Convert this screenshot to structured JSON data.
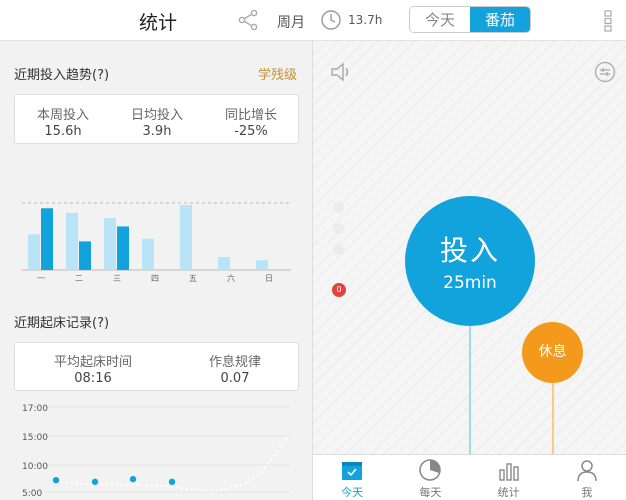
{
  "header": {
    "title": "统计",
    "period": "周月",
    "hours": "13.7h",
    "tab_today": "今天",
    "tab_tomato": "番茄",
    "icons": {
      "share": "share-icon",
      "clock": "clock-icon",
      "more": "more-vertical-icon"
    }
  },
  "trend": {
    "title": "近期投入趋势(?)",
    "level": "学残级",
    "stats": [
      {
        "label": "本周投入",
        "value": "15.6h"
      },
      {
        "label": "日均投入",
        "value": "3.9h"
      },
      {
        "label": "同比增长",
        "value": "-25%"
      }
    ]
  },
  "chart_data": [
    {
      "type": "bar",
      "categories": [
        "一",
        "二",
        "三",
        "四",
        "五",
        "六",
        "日"
      ],
      "series": [
        {
          "values": [
            0.55,
            0.88,
            0.8,
            0.48,
            1.0,
            0.2,
            0.15
          ],
          "color": "#b9e3f6"
        },
        {
          "values": [
            0.95,
            0.44,
            0.67,
            null,
            null,
            null,
            null
          ],
          "color": "#13a3dc"
        }
      ],
      "baseline_dashed": true,
      "grid": false
    },
    {
      "type": "line",
      "yticks": [
        "17:00",
        "15:00",
        "10:00",
        "5:00"
      ],
      "points_y": [
        0.44,
        0.47,
        0.42,
        0.47
      ],
      "point_color": "#13a3dc",
      "line_style": "dotted"
    }
  ],
  "wake": {
    "title": "近期起床记录(?)",
    "stats": [
      {
        "label": "平均起床时间",
        "value": "08:16"
      },
      {
        "label": "作息规律",
        "value": "0.07"
      }
    ]
  },
  "timer": {
    "work_title": "投入",
    "work_duration": "25min",
    "rest_title": "休息",
    "badge_count": "0",
    "colors": {
      "work": "#13a3dc",
      "rest": "#f39a1d"
    },
    "icons": {
      "volume": "volume-icon",
      "settings": "settings-sliders-icon"
    }
  },
  "nav": {
    "items": [
      {
        "label": "今天",
        "icon": "calendar-icon",
        "active": true
      },
      {
        "label": "每天",
        "icon": "pie-chart-icon",
        "active": false
      },
      {
        "label": "统计",
        "icon": "bar-chart-icon",
        "active": false
      },
      {
        "label": "我",
        "icon": "user-icon",
        "active": false
      }
    ]
  }
}
